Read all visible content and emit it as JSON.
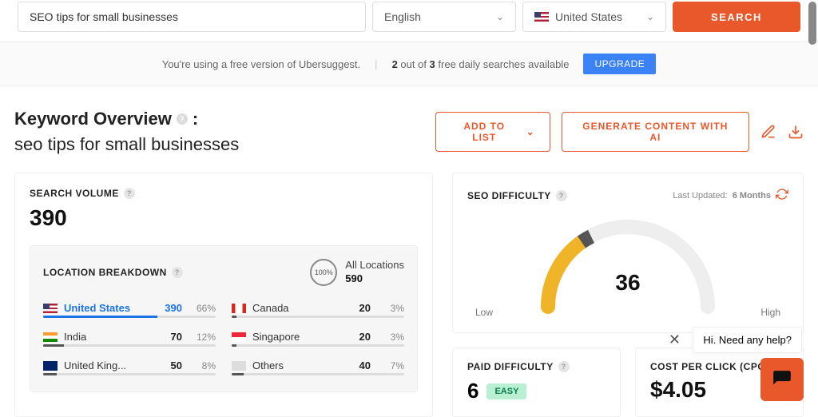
{
  "search": {
    "keyword": "SEO tips for small businesses",
    "language": "English",
    "country": "United States",
    "button": "SEARCH"
  },
  "notice": {
    "free_msg_prefix": "You're using a free version of ",
    "product": "Ubersuggest",
    "daily_current": "2",
    "daily_mid": " out of ",
    "daily_total": "3",
    "daily_suffix": " free daily searches available",
    "upgrade": "UPGRADE"
  },
  "header": {
    "title": "Keyword Overview",
    "keyword": "seo tips for small businesses",
    "add_to_list": "ADD TO LIST",
    "generate_ai": "GENERATE CONTENT WITH AI"
  },
  "search_volume": {
    "label": "SEARCH VOLUME",
    "value": "390"
  },
  "location": {
    "label": "LOCATION BREAKDOWN",
    "all_label": "All Locations",
    "all_value": "590",
    "circle": "100%",
    "rows": [
      {
        "name": "United States",
        "value": "390",
        "pct": "66%",
        "fill": 66,
        "flag": "us",
        "active": true
      },
      {
        "name": "India",
        "value": "70",
        "pct": "12%",
        "fill": 12,
        "flag": "in"
      },
      {
        "name": "United King...",
        "value": "50",
        "pct": "8%",
        "fill": 8,
        "flag": "uk"
      },
      {
        "name": "Canada",
        "value": "20",
        "pct": "3%",
        "fill": 3,
        "flag": "ca"
      },
      {
        "name": "Singapore",
        "value": "20",
        "pct": "3%",
        "fill": 3,
        "flag": "sg"
      },
      {
        "name": "Others",
        "value": "40",
        "pct": "7%",
        "fill": 7,
        "flag": "other"
      }
    ]
  },
  "seo_difficulty": {
    "label": "SEO DIFFICULTY",
    "last_updated_label": "Last Updated:",
    "last_updated_value": "6 Months",
    "value": "36",
    "low": "Low",
    "high": "High"
  },
  "paid_difficulty": {
    "label": "PAID DIFFICULTY",
    "value": "6",
    "badge": "EASY"
  },
  "cpc": {
    "label": "COST PER CLICK (CPC)",
    "value": "$4.05"
  },
  "chat": {
    "text": "Hi. Need any help?"
  }
}
